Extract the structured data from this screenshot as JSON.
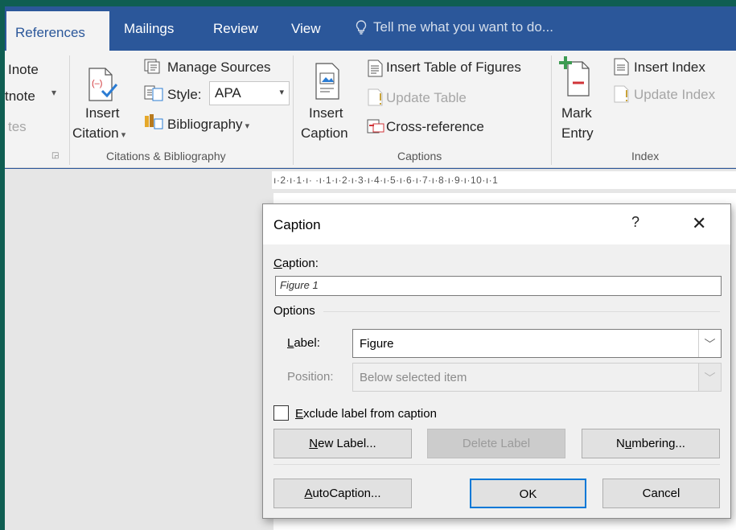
{
  "tabs": {
    "references": "References",
    "mailings": "Mailings",
    "review": "Review",
    "view": "View",
    "tell_me": "Tell me what you want to do..."
  },
  "ribbon": {
    "footnotes": {
      "item1": "Inote",
      "item2": "tnote",
      "item3": "tes"
    },
    "citations": {
      "insert_citation_1": "Insert",
      "insert_citation_2": "Citation",
      "manage_sources": "Manage Sources",
      "style_label": "Style:",
      "style_value": "APA",
      "bibliography": "Bibliography",
      "group_label": "Citations & Bibliography"
    },
    "captions": {
      "insert_caption_1": "Insert",
      "insert_caption_2": "Caption",
      "insert_table_of_figures": "Insert Table of Figures",
      "update_table": "Update Table",
      "cross_reference": "Cross-reference",
      "group_label": "Captions"
    },
    "index": {
      "mark_entry_1": "Mark",
      "mark_entry_2": "Entry",
      "insert_index": "Insert Index",
      "update_index": "Update Index",
      "group_label": "Index"
    }
  },
  "ruler": {
    "text": "ı·2·ı·1·ı·  ·ı·1·ı·2·ı·3·ı·4·ı·5·ı·6·ı·7·ı·8·ı·9·ı·10·ı·1"
  },
  "dialog": {
    "title": "Caption",
    "help": "?",
    "close": "✕",
    "caption_label_u": "C",
    "caption_label_rest": "aption:",
    "caption_value": "Figure 1",
    "options_label": "Options",
    "label_label_u": "L",
    "label_label_rest": "abel:",
    "label_value": "Figure",
    "position_label": "Position:",
    "position_value": "Below selected item",
    "exclude_u": "E",
    "exclude_rest": "xclude label from caption",
    "exclude_checked": false,
    "new_label_u": "N",
    "new_label_rest": "ew Label...",
    "delete_label": "Delete Label",
    "numbering_pre": "N",
    "numbering_u": "u",
    "numbering_rest": "mbering...",
    "autocaption_u": "A",
    "autocaption_rest": "utoCaption...",
    "ok": "OK",
    "cancel": "Cancel"
  },
  "colors": {
    "tab_bar": "#2b579a",
    "frame": "#0f5e52",
    "ribbon_bg": "#f3f3f3",
    "default_button_border": "#0078d7"
  }
}
